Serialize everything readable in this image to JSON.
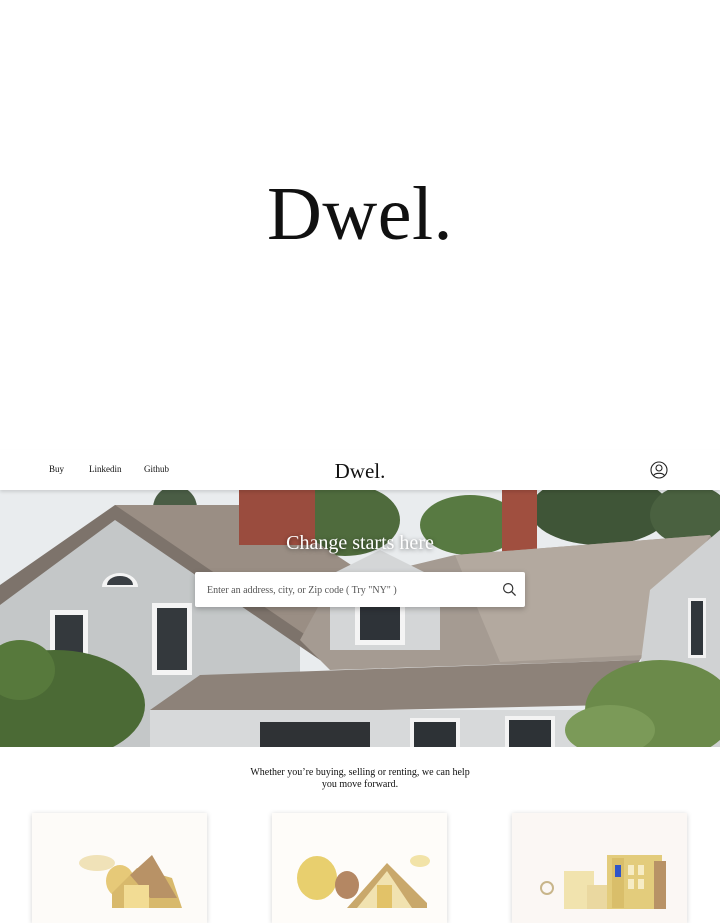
{
  "splash": {
    "logo": "Dwel."
  },
  "nav": {
    "links": [
      "Buy",
      "Linkedin",
      "Github"
    ],
    "logo": "Dwel.",
    "user_icon": "user-circle-icon"
  },
  "hero": {
    "title": "Change starts here",
    "search": {
      "placeholder": "Enter an address, city, or Zip code ( Try \"NY\" )",
      "icon": "search-icon"
    }
  },
  "tagline": "Whether you’re buying, selling or renting, we can help you move forward.",
  "cards": [
    {
      "illustration": "house-illustration-icon"
    },
    {
      "illustration": "house-trees-illustration-icon"
    },
    {
      "illustration": "city-buildings-illustration-icon"
    }
  ],
  "colors": {
    "text": "#111111",
    "roof": "#8f8378",
    "siding": "#c5c8c9",
    "illustration_gold": "#e0c15a"
  }
}
